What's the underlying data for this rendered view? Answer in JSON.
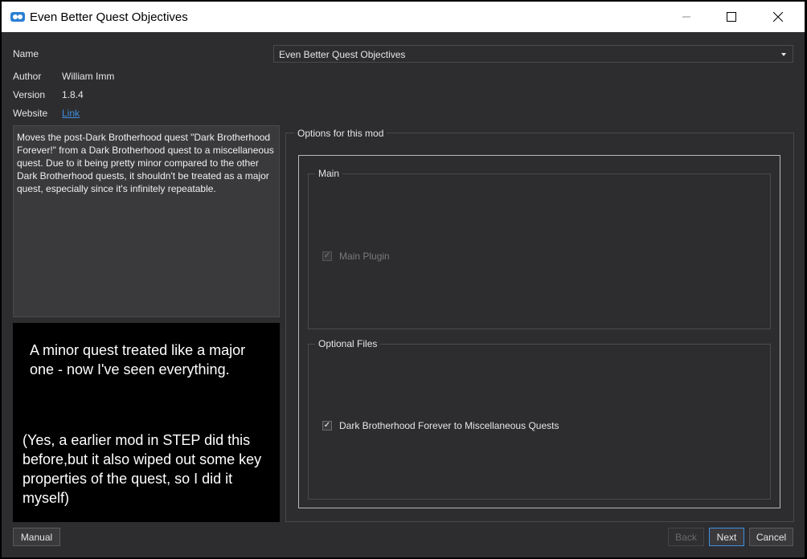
{
  "window": {
    "title": "Even Better Quest Objectives",
    "icon": "mod-organizer-icon"
  },
  "info": {
    "name_label": "Name",
    "name_value": "Even Better Quest Objectives",
    "author_label": "Author",
    "author_value": "William Imm",
    "version_label": "Version",
    "version_value": "1.8.4",
    "website_label": "Website",
    "website_link": "Link"
  },
  "description": "Moves the post-Dark Brotherhood quest \"Dark Brotherhood Forever!\" from a Dark Brotherhood quest to a miscellaneous quest. Due to it being pretty minor compared to the other Dark Brotherhood quests, it shouldn't be treated as a major quest, especially since it's infinitely repeatable.",
  "image_text": {
    "line1": "A minor quest  treated like a major one - now I've seen everything.",
    "line2": "(Yes, a earlier mod in STEP did this before,but it also wiped out some key properties of the quest, so I did it myself)"
  },
  "options": {
    "title": "Options for this mod",
    "groups": [
      {
        "title": "Main",
        "items": [
          {
            "label": "Main Plugin",
            "checked": true,
            "enabled": false
          }
        ]
      },
      {
        "title": "Optional Files",
        "items": [
          {
            "label": "Dark Brotherhood Forever to Miscellaneous Quests",
            "checked": true,
            "enabled": true
          }
        ]
      }
    ]
  },
  "buttons": {
    "manual": "Manual",
    "back": "Back",
    "next": "Next",
    "cancel": "Cancel"
  },
  "colors": {
    "background": "#2d2d30",
    "accent": "#3f8fe0",
    "link": "#3f8fe0"
  }
}
